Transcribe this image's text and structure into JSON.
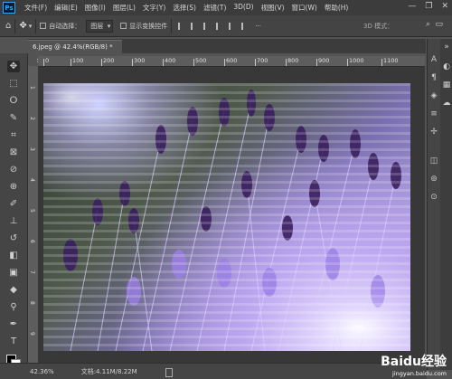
{
  "app": {
    "logo": "Ps"
  },
  "menu": {
    "items": [
      "文件(F)",
      "编辑(E)",
      "图像(I)",
      "图层(L)",
      "文字(Y)",
      "选择(S)",
      "滤镜(T)",
      "3D(D)",
      "视图(V)",
      "窗口(W)",
      "帮助(H)"
    ]
  },
  "window_controls": {
    "minimize": "—",
    "restore": "❐",
    "close": "✕"
  },
  "options_bar": {
    "auto_select_label": "自动选择：",
    "auto_select_value": "图层",
    "show_transform_label": "显示变换控件",
    "mode_label": "3D 模式："
  },
  "document": {
    "tab_title": "6.jpeg @ 42.4%(RGB/8) *",
    "close": "×"
  },
  "ruler": {
    "h_labels": [
      "0",
      "100",
      "200",
      "300",
      "400",
      "500",
      "600",
      "700",
      "800",
      "900",
      "1000",
      "1100"
    ],
    "v_labels": [
      "1",
      "2",
      "3",
      "4",
      "5",
      "6",
      "7",
      "8",
      "9"
    ]
  },
  "status": {
    "zoom": "42.36%",
    "doc_info": "文档:4.11M/8.22M"
  },
  "watermark": {
    "logo": "Baidu经验",
    "url": "jingyan.baidu.com"
  },
  "colors": {
    "accent": "#31a8ff",
    "photo_purple": "#a38be6"
  }
}
